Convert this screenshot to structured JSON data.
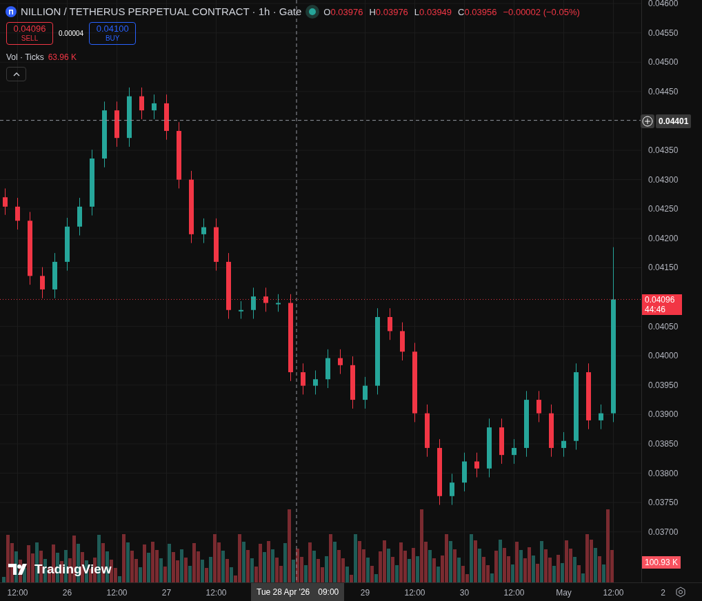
{
  "legend": {
    "title": "NILLION / TETHERUS PERPETUAL CONTRACT · 1h · Gate",
    "ohlc": [
      {
        "label": "O",
        "value": "0.03976"
      },
      {
        "label": "H",
        "value": "0.03976"
      },
      {
        "label": "L",
        "value": "0.03949"
      },
      {
        "label": "C",
        "value": "0.03956"
      }
    ],
    "change": "−0.00002 (−0.05%)"
  },
  "trade_buttons": [
    {
      "kind": "sell",
      "price": "0.04096",
      "label": "SELL"
    },
    {
      "kind": "buy",
      "price": "0.04100",
      "label": "BUY"
    }
  ],
  "spread": "0.00004",
  "volume_legend": {
    "label": "Vol · Ticks",
    "value": "63.96 K"
  },
  "crosshair": {
    "price": "0.04401",
    "date": "Tue 28 Apr '26",
    "time": "09:00"
  },
  "last_price": {
    "price": "0.04096",
    "countdown": "44:46"
  },
  "volume_label": "100.93 K",
  "watermark_logo": "TradingView",
  "chart_data": {
    "type": "candlestick",
    "ylim": [
      0.03614,
      0.04606
    ],
    "grid": true,
    "ref_lines": [
      {
        "axis": "y",
        "value": 0.04401,
        "color": "#9598a1"
      },
      {
        "axis": "y",
        "value": 0.04096,
        "color": "#f23645"
      }
    ],
    "categories": [
      null,
      "12:00",
      null,
      null,
      null,
      "26",
      null,
      null,
      null,
      "12:00",
      null,
      null,
      null,
      "27",
      null,
      null,
      null,
      "12:00",
      null,
      null,
      null,
      null,
      null,
      null,
      null,
      null,
      null,
      null,
      null,
      "29",
      null,
      null,
      null,
      "12:00",
      null,
      null,
      null,
      "30",
      null,
      null,
      null,
      "12:00",
      null,
      null,
      null,
      "May",
      null,
      null,
      null,
      "12:00",
      null,
      null,
      null,
      "2"
    ],
    "ohlc": [
      [
        0.0427,
        0.04285,
        0.0424,
        0.04254
      ],
      [
        0.04254,
        0.04269,
        0.04215,
        0.0423
      ],
      [
        0.0423,
        0.04245,
        0.04121,
        0.04136
      ],
      [
        0.04136,
        0.04151,
        0.04098,
        0.04113
      ],
      [
        0.04113,
        0.04175,
        0.04098,
        0.0416
      ],
      [
        0.0416,
        0.04235,
        0.04145,
        0.0422
      ],
      [
        0.0422,
        0.04269,
        0.04205,
        0.04254
      ],
      [
        0.04254,
        0.04351,
        0.04239,
        0.04336
      ],
      [
        0.04336,
        0.04433,
        0.04321,
        0.04418
      ],
      [
        0.04418,
        0.04433,
        0.04356,
        0.04371
      ],
      [
        0.04371,
        0.04457,
        0.04356,
        0.04442
      ],
      [
        0.04442,
        0.04457,
        0.04403,
        0.04418
      ],
      [
        0.04418,
        0.04445,
        0.04403,
        0.0443
      ],
      [
        0.0443,
        0.04445,
        0.04368,
        0.04383
      ],
      [
        0.04383,
        0.04398,
        0.04285,
        0.043
      ],
      [
        0.043,
        0.04315,
        0.04192,
        0.04207
      ],
      [
        0.04207,
        0.04234,
        0.04192,
        0.04219
      ],
      [
        0.04219,
        0.04234,
        0.04145,
        0.0416
      ],
      [
        0.0416,
        0.04175,
        0.04063,
        0.04078
      ],
      [
        0.04078,
        0.04093,
        0.04063,
        0.04078
      ],
      [
        0.04078,
        0.04116,
        0.04063,
        0.04101
      ],
      [
        0.04101,
        0.04116,
        0.04075,
        0.0409
      ],
      [
        0.0409,
        0.04105,
        0.04075,
        0.0409
      ],
      [
        0.0409,
        0.04105,
        0.03957,
        0.03972
      ],
      [
        0.03972,
        0.03987,
        0.03934,
        0.03949
      ],
      [
        0.03949,
        0.03975,
        0.03934,
        0.0396
      ],
      [
        0.0396,
        0.04011,
        0.03945,
        0.03996
      ],
      [
        0.03996,
        0.04011,
        0.03969,
        0.03984
      ],
      [
        0.03984,
        0.03999,
        0.0391,
        0.03925
      ],
      [
        0.03925,
        0.03964,
        0.0391,
        0.03949
      ],
      [
        0.03949,
        0.04081,
        0.03934,
        0.04066
      ],
      [
        0.04066,
        0.04081,
        0.04027,
        0.04042
      ],
      [
        0.04042,
        0.04057,
        0.03992,
        0.04007
      ],
      [
        0.04007,
        0.04022,
        0.03887,
        0.03902
      ],
      [
        0.03902,
        0.03917,
        0.03828,
        0.03843
      ],
      [
        0.03843,
        0.03858,
        0.03746,
        0.03761
      ],
      [
        0.03761,
        0.03799,
        0.03746,
        0.03784
      ],
      [
        0.03784,
        0.03835,
        0.03769,
        0.0382
      ],
      [
        0.0382,
        0.03835,
        0.03793,
        0.03808
      ],
      [
        0.03808,
        0.03893,
        0.03793,
        0.03878
      ],
      [
        0.03878,
        0.03893,
        0.03816,
        0.03831
      ],
      [
        0.03831,
        0.03858,
        0.03816,
        0.03843
      ],
      [
        0.03843,
        0.0394,
        0.03828,
        0.03925
      ],
      [
        0.03925,
        0.0394,
        0.03887,
        0.03902
      ],
      [
        0.03902,
        0.03917,
        0.03828,
        0.03843
      ],
      [
        0.03843,
        0.0387,
        0.03828,
        0.03855
      ],
      [
        0.03855,
        0.03987,
        0.0384,
        0.03972
      ],
      [
        0.03972,
        0.03987,
        0.03875,
        0.0389
      ],
      [
        0.0389,
        0.03917,
        0.03875,
        0.03902
      ],
      [
        0.03902,
        0.04185,
        0.03887,
        0.04096
      ],
      null,
      null,
      null,
      null
    ],
    "yticks": [
      {
        "value": 0.046,
        "label": "0.04600"
      },
      {
        "value": 0.0455,
        "label": "0.04550"
      },
      {
        "value": 0.045,
        "label": "0.04500"
      },
      {
        "value": 0.0445,
        "label": "0.04450"
      },
      {
        "value": 0.0435,
        "label": "0.04350"
      },
      {
        "value": 0.043,
        "label": "0.04300"
      },
      {
        "value": 0.0425,
        "label": "0.04250"
      },
      {
        "value": 0.042,
        "label": "0.04200"
      },
      {
        "value": 0.0415,
        "label": "0.04150"
      },
      {
        "value": 0.0405,
        "label": "0.04050"
      },
      {
        "value": 0.04,
        "label": "0.04000"
      },
      {
        "value": 0.0395,
        "label": "0.03950"
      },
      {
        "value": 0.039,
        "label": "0.03900"
      },
      {
        "value": 0.0385,
        "label": "0.03850"
      },
      {
        "value": 0.038,
        "label": "0.03800"
      },
      {
        "value": 0.0375,
        "label": "0.03750"
      },
      {
        "value": 0.037,
        "label": "0.03700"
      }
    ]
  }
}
